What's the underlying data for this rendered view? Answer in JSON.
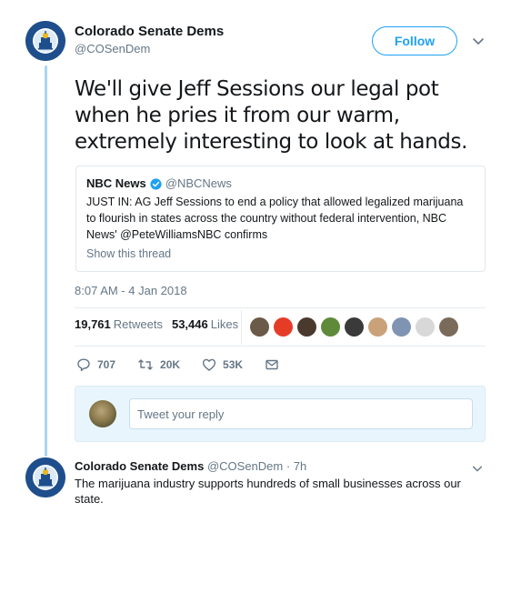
{
  "account": {
    "display_name": "Colorado Senate Dems",
    "handle": "@COSenDem",
    "logo_ring_text": "COLORADO SENATE DEMOCRATS"
  },
  "follow_label": "Follow",
  "tweet": {
    "text": "We'll give Jeff Sessions our legal pot when he pries it from our warm, extremely interesting to look at hands.",
    "timestamp": "8:07 AM - 4 Jan 2018"
  },
  "quote": {
    "name": "NBC News",
    "handle": "@NBCNews",
    "text": "JUST IN: AG Jeff Sessions to end a policy that allowed legalized marijuana to flourish in states across the country without federal intervention, NBC News' @PeteWilliamsNBC confirms",
    "show_thread": "Show this thread"
  },
  "stats": {
    "retweets_count": "19,761",
    "retweets_label": "Retweets",
    "likes_count": "53,446",
    "likes_label": "Likes"
  },
  "likers": [
    "#6b5a48",
    "#e53c28",
    "#4a3a2e",
    "#5f8a3a",
    "#3a3a3a",
    "#c9a27a",
    "#7f94b3",
    "#d8d8d8",
    "#7a6a5a"
  ],
  "actions": {
    "replies": "707",
    "retweets": "20K",
    "likes": "53K"
  },
  "reply": {
    "placeholder": "Tweet your reply"
  },
  "tweet2": {
    "name": "Colorado Senate Dems",
    "handle": "@COSenDem",
    "time": "· 7h",
    "text": "The marijuana industry supports hundreds of small businesses across our state."
  },
  "colors": {
    "accent": "#1da1f2",
    "thread_line": "#a9d6f4",
    "muted": "#657786",
    "logo_blue": "#1f4e8c"
  }
}
